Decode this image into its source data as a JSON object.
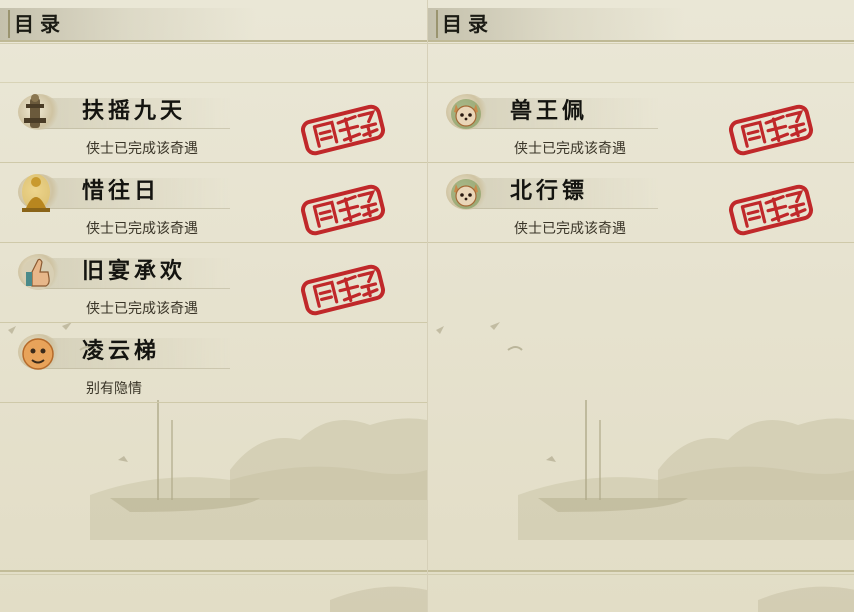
{
  "left_panel": {
    "title": "目录",
    "entries": [
      {
        "name": "扶摇九天",
        "status": "侠士已完成该奇遇",
        "completed": true,
        "icon": "pillar-icon"
      },
      {
        "name": "惜往日",
        "status": "侠士已完成该奇遇",
        "completed": true,
        "icon": "golden-buddha-icon"
      },
      {
        "name": "旧宴承欢",
        "status": "侠士已完成该奇遇",
        "completed": true,
        "icon": "thumbs-up-icon"
      },
      {
        "name": "凌云梯",
        "status": "别有隐情",
        "completed": false,
        "icon": "face-icon"
      }
    ]
  },
  "right_panel": {
    "title": "目录",
    "entries": [
      {
        "name": "兽王佩",
        "status": "侠士已完成该奇遇",
        "completed": true,
        "icon": "fox-pet-icon"
      },
      {
        "name": "北行镖",
        "status": "侠士已完成该奇遇",
        "completed": true,
        "icon": "fox-pet-icon"
      }
    ]
  },
  "colors": {
    "stamp_red": "#c0282a",
    "ink": "#141410",
    "parchment": "#e7e3d0"
  }
}
